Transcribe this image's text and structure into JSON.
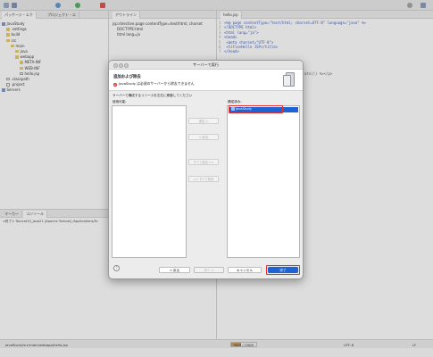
{
  "left_panel": {
    "tabs": [
      "パッケージ・エク",
      "プロジェクト・エ"
    ],
    "tree": [
      {
        "label": "JavaStudy",
        "depth": 0,
        "icon": "project-icon"
      },
      {
        "label": ".settings",
        "depth": 1,
        "icon": "folder-icon"
      },
      {
        "label": "build",
        "depth": 1,
        "icon": "folder-icon"
      },
      {
        "label": "src",
        "depth": 1,
        "icon": "folder-icon"
      },
      {
        "label": "main",
        "depth": 2,
        "icon": "folder-icon"
      },
      {
        "label": "java",
        "depth": 3,
        "icon": "folder-icon"
      },
      {
        "label": "webapp",
        "depth": 3,
        "icon": "folder-icon"
      },
      {
        "label": "META-INF",
        "depth": 4,
        "icon": "folder-icon"
      },
      {
        "label": "WEB-INF",
        "depth": 4,
        "icon": "folder-icon"
      },
      {
        "label": "hello.jsp",
        "depth": 4,
        "icon": "file-icon"
      },
      {
        "label": ".classpath",
        "depth": 1,
        "icon": "file-icon"
      },
      {
        "label": ".project",
        "depth": 1,
        "icon": "file-icon"
      },
      {
        "label": "Servers",
        "depth": 0,
        "icon": "project-icon"
      }
    ]
  },
  "outline": {
    "tab": "アウトライン",
    "rows": [
      "jsp:directive.page contentType=text/html; charset",
      "DOCTYPE:html",
      "html lang=ja"
    ]
  },
  "editor": {
    "tab": "hello.jsp",
    "lines": [
      {
        "n": "1",
        "text": "<%@ page contentType=\"text/html; charset=UTF-8\" language=\"java\" %>"
      },
      {
        "n": "2",
        "text": "<!DOCTYPE html>"
      },
      {
        "n": "3",
        "text": "<html lang=\"ja\">"
      },
      {
        "n": "4",
        "text": "<head>"
      },
      {
        "n": "5",
        "text": "    <meta charset=\"UTF-8\">"
      },
      {
        "n": "6",
        "text": "    <title>Hello JSP</title>"
      },
      {
        "n": "7",
        "text": "</head>"
      }
    ],
    "tail": "ate()) %></p>"
  },
  "console": {
    "tabs": [
      "マーカー",
      "コンソール"
    ],
    "text": "<終了> Tomcat10_Java21 [Apache Tomcat] /Applications/Ec"
  },
  "status": {
    "path": "JavaStudy/src/main/webapp/hello.jsp",
    "memory": "98/M / 256/M",
    "memory_fraction": 0.38,
    "encoding": "UTF-8",
    "mode": "LF"
  },
  "dialog": {
    "window_title": "サーバーで実行",
    "header_title": "追加および除去",
    "error_message": "JavaStudy は必須のサーバーから除去できません",
    "instruction": "サーバーで構成するリソースを左右に移動してください",
    "available_label": "使用可能:",
    "configured_label": "構成済み:",
    "configured_items": [
      "JavaStudy"
    ],
    "move_buttons": [
      "追加 >",
      "< 除去",
      "すべて追加 >>",
      "<< すべて除去"
    ],
    "help_label": "?",
    "footer_buttons": {
      "back": "< 戻る",
      "next": "次へ >",
      "cancel": "キャンセル",
      "finish": "完了"
    },
    "accent": "#1e63d6",
    "highlight": "#e5302a"
  }
}
